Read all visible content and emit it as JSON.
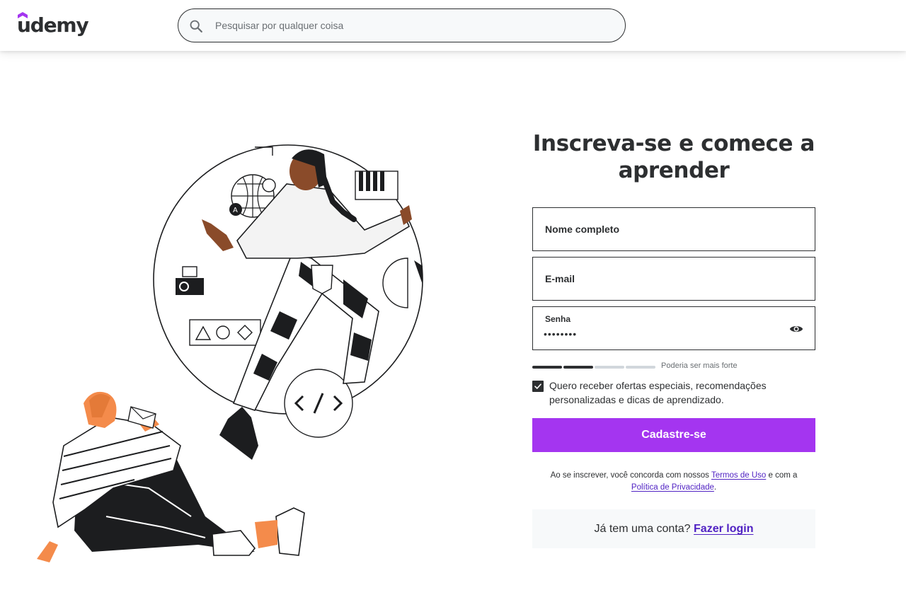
{
  "header": {
    "logo_text": "udemy",
    "logo_accent": "#a435f0",
    "search_placeholder": "Pesquisar por qualquer coisa",
    "search_icon": "search-icon"
  },
  "signup": {
    "title": "Inscreva-se e comece a aprender",
    "name_label": "Nome completo",
    "email_label": "E-mail",
    "password_label": "Senha",
    "password_value": "••••••••",
    "password_toggle_icon": "eye-icon",
    "strength": {
      "level": 2,
      "total": 4,
      "label": "Poderia ser mais forte",
      "filled_color": "#2d2f31",
      "empty_color": "#d1d7dc"
    },
    "offers_checkbox": {
      "checked": true,
      "label": "Quero receber ofertas especiais, recomendações personalizadas e dicas de aprendizado."
    },
    "submit_label": "Cadastre-se",
    "submit_color": "#a435f0",
    "terms": {
      "prefix": "Ao se inscrever, você concorda com nossos",
      "terms_link": "Termos de Uso",
      "middle": "e com a",
      "privacy_link": "Política de Privacidade",
      "suffix": "."
    },
    "login_prompt": {
      "text": "Já tem uma conta?",
      "link": "Fazer login"
    }
  }
}
